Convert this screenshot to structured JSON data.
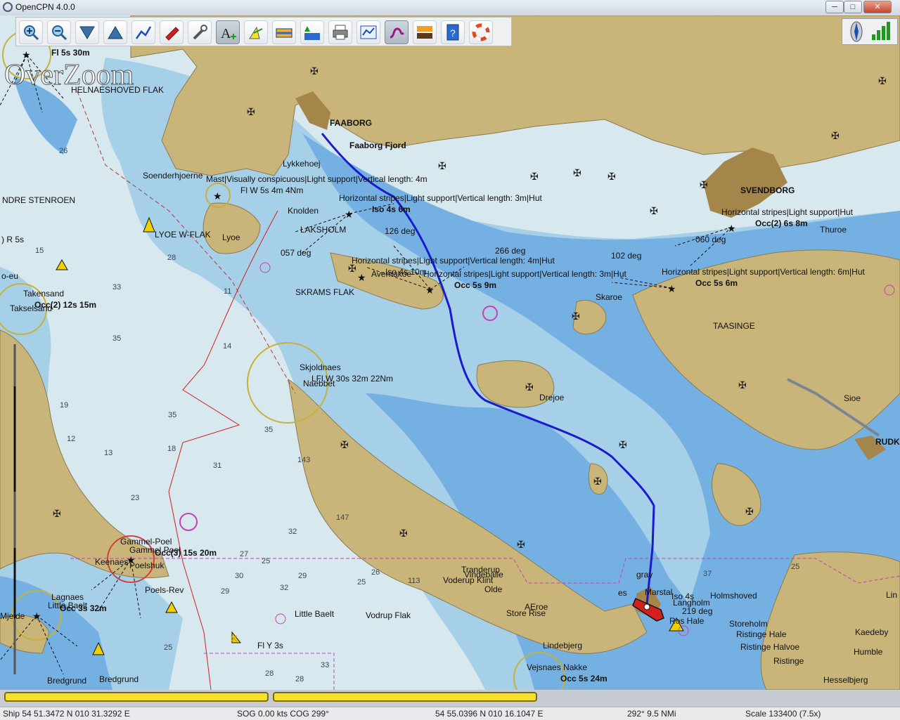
{
  "window": {
    "title": "OpenCPN 4.0.0",
    "buttons": [
      "─",
      "□",
      "✕"
    ]
  },
  "toolbar": {
    "tools": [
      {
        "name": "zoom-in-icon"
      },
      {
        "name": "zoom-out-icon"
      },
      {
        "name": "scale-in-icon"
      },
      {
        "name": "scale-out-icon"
      },
      {
        "name": "route-icon"
      },
      {
        "name": "drop-mark-icon"
      },
      {
        "name": "settings-icon"
      },
      {
        "name": "text-icon"
      },
      {
        "name": "ais-icon"
      },
      {
        "name": "current-icon"
      },
      {
        "name": "tide-icon"
      },
      {
        "name": "print-icon"
      },
      {
        "name": "route-manager-icon"
      },
      {
        "name": "track-icon"
      },
      {
        "name": "color-scheme-icon"
      },
      {
        "name": "help-icon"
      },
      {
        "name": "mob-icon"
      }
    ],
    "active_tool": "text-icon"
  },
  "overlay": {
    "overzoom": "OverZoom"
  },
  "places": {
    "faaborg": "FAABORG",
    "faaborg_fjord": "Faaborg Fjord",
    "lykkehoej": "Lykkehoej",
    "svendborg": "SVENDBORG",
    "thuroe": "Thuroe",
    "taasinge": "TAASINGE",
    "skaroe": "Skaroe",
    "drejoe": "Drejoe",
    "sioe": "Sioe",
    "rudk": "RUDK",
    "lyoe": "Lyoe",
    "knolden": "Knolden",
    "lakshlm": "LAKSHOLM",
    "skrams_flak": "SKRAMS FLAK",
    "lyoe_w_flak": "LYOE W-FLAK",
    "soenderhjoerne": "Soenderhjoerne",
    "nordre_stenroen": "NDRE STENROEN",
    "helnaeshoved_flak": "HELNAESHOVED FLAK",
    "takensand": "Takensand",
    "takselsand": "Takselsand",
    "skjoldnaes": "Skjoldnaes",
    "naebbet": "Naebbet",
    "gammel_poel": "Gammel-Poel",
    "gammel_poel2": "Gammel Poel",
    "keenaes": "Keenaes",
    "poelshuk": "Poelshuk",
    "poels_rev": "Poels-Rev",
    "lille_baelt": "Little Baelt",
    "lille_baelt2": "Little Baelt",
    "vodrup_flak": "Vodrup Flak",
    "tranderup": "Tranderup",
    "vindeballe": "Vindeballe",
    "voderup_klint": "Voderup Klint",
    "olde": "Olde",
    "aeroe": "AEroe",
    "store_rise": "Store Rise",
    "lindebjerg": "Lindebjerg",
    "vejsnaes_nakke": "Vejsnaes Nakke",
    "marstal": "Marstal",
    "langholm": "Langholm",
    "holmshoved": "Holmshoved",
    "storeholm": "Storeholm",
    "ristinge_hale": "Ristinge Hale",
    "ristinge_halvoe": "Ristinge Halvoe",
    "ristinge": "Ristinge",
    "kaedeby": "Kaedeby",
    "humble": "Humble",
    "hesselbjerg": "Hesselbjerg",
    "bredgrund": "Bredgrund",
    "bredgrund2": "Bredgrund",
    "lagnaes": "Lagnaes",
    "ruds_hale": "Ros Hale",
    "aeroe_caps": "AEROE",
    "lin": "Lin",
    "es": "es",
    "bagenkop": "Mjelde"
  },
  "lights": {
    "fl5s30m": "Fl 5s 30m",
    "mast": "Mast|Visually conspicuous|Light support|Vertical length: 4m",
    "flw5s": "Fl W 5s 4m 4Nm",
    "horiz1": "Horizontal stripes|Light support|Vertical length: 3m|Hut",
    "iso4s6m": "Iso 4s 6m",
    "horiz2": "Horizontal stripes|Light support|Vertical length: 4m|Hut",
    "horiz3": "Horizontal stripes|Light support|Vertical length: 3m|Hut",
    "avernakoe": "Avernakoe",
    "occ5s9m": "Occ 5s 9m",
    "horiz4": "Horizontal stripes|Light support|Hut",
    "occ2_6s8m": "Occ(2) 6s 8m",
    "horiz5": "Horizontal stripes|Light support|Vertical length: 6m|Hut",
    "occ5s6m": "Occ 5s 6m",
    "occ2_12s15m": "Occ(2) 12s 15m",
    "lflw30s": "LFl W 30s 32m 22Nm",
    "occ3_15s20m": "Occ(3) 15s 20m",
    "occ3s32m": "Occ 3s 32m",
    "fly3s": "Fl Y 3s",
    "occ5s24m": "Occ 5s 24m",
    "r5s": ") R 5s",
    "eu": "o-eu",
    "iso4s10m": "Iso 4s 10m",
    "ros": "Ros",
    "gray": "gray",
    "occ_short": "Iso 4s"
  },
  "bearings": {
    "b126": "126 deg",
    "b057": "057 deg",
    "b266": "266 deg",
    "b102": "102 deg",
    "b060": "060 deg",
    "b219": "219 deg"
  },
  "soundings": [
    "26",
    "28",
    "33",
    "35",
    "35",
    "35",
    "31",
    "32",
    "27",
    "25",
    "29",
    "30",
    "26",
    "32",
    "25",
    "29",
    "28",
    "33",
    "28",
    "14",
    "11",
    "18",
    "19",
    "15",
    "12",
    "13",
    "25",
    "23",
    "143",
    "147",
    "113",
    "25",
    "37"
  ],
  "statusbar": {
    "ship": "Ship 54 51.3472 N   010 31.3292 E",
    "sog": "SOG 0.00 kts  COG 299°",
    "cursor": "54 55.0396 N   010 16.1047 E",
    "range": "292°  9.5 NMi",
    "scale": "Scale 133400 (7.5x)"
  },
  "colors": {
    "land": "#c9b57a",
    "deep": "#d8e8ef",
    "shallow": "#a6cfe8",
    "vshallow": "#75b0e3",
    "town": "#a4864a",
    "route": "#1a1acf"
  }
}
